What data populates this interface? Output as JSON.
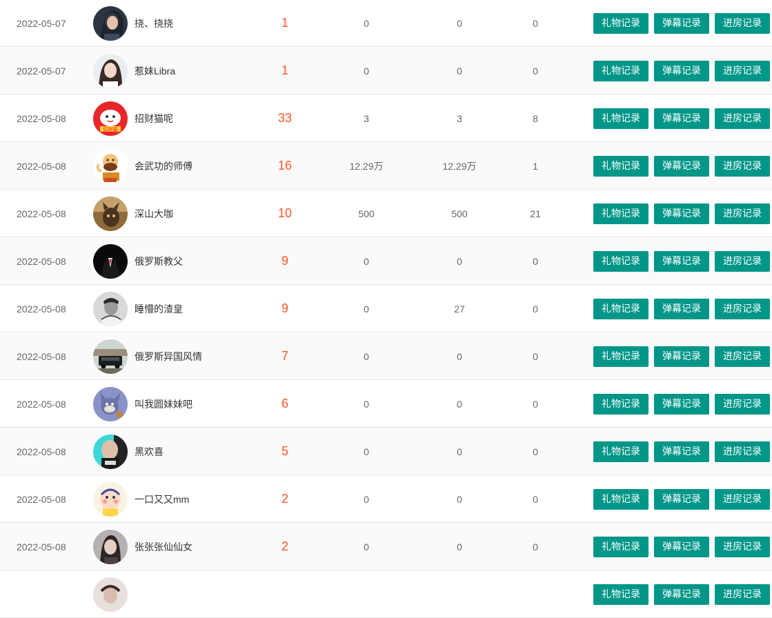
{
  "buttons": {
    "gift": "礼物记录",
    "danmu": "弹幕记录",
    "enter": "进房记录"
  },
  "rows": [
    {
      "date": "2022-05-07",
      "name": "挠、挠挠",
      "count": "1",
      "v1": "0",
      "v2": "0",
      "v3": "0",
      "avatar": "avatar-woman-dark-hair"
    },
    {
      "date": "2022-05-07",
      "name": "惹妹Libra",
      "count": "1",
      "v1": "0",
      "v2": "0",
      "v3": "0",
      "avatar": "avatar-woman-light"
    },
    {
      "date": "2022-05-08",
      "name": "招财猫呢",
      "count": "33",
      "v1": "3",
      "v2": "3",
      "v3": "8",
      "avatar": "avatar-lucky-cat"
    },
    {
      "date": "2022-05-08",
      "name": "会武功的师傅",
      "count": "16",
      "v1": "12.29万",
      "v2": "12.29万",
      "v3": "1",
      "avatar": "avatar-cartoon-master"
    },
    {
      "date": "2022-05-08",
      "name": "深山大咖",
      "count": "10",
      "v1": "500",
      "v2": "500",
      "v3": "21",
      "avatar": "avatar-animal"
    },
    {
      "date": "2022-05-08",
      "name": "俄罗斯教父",
      "count": "9",
      "v1": "0",
      "v2": "0",
      "v3": "0",
      "avatar": "avatar-suit"
    },
    {
      "date": "2022-05-08",
      "name": "睡懵的渣皇",
      "count": "9",
      "v1": "0",
      "v2": "27",
      "v3": "0",
      "avatar": "avatar-man-bw"
    },
    {
      "date": "2022-05-08",
      "name": "俄罗斯异国风情",
      "count": "7",
      "v1": "0",
      "v2": "0",
      "v3": "0",
      "avatar": "avatar-car"
    },
    {
      "date": "2022-05-08",
      "name": "叫我圆妹妹吧",
      "count": "6",
      "v1": "0",
      "v2": "0",
      "v3": "0",
      "avatar": "avatar-tom-cat"
    },
    {
      "date": "2022-05-08",
      "name": "黑欢喜",
      "count": "5",
      "v1": "0",
      "v2": "0",
      "v3": "0",
      "avatar": "avatar-man-bald"
    },
    {
      "date": "2022-05-08",
      "name": "一口又又mm",
      "count": "2",
      "v1": "0",
      "v2": "0",
      "v3": "0",
      "avatar": "avatar-cartoon-baby"
    },
    {
      "date": "2022-05-08",
      "name": "张张张仙仙女",
      "count": "2",
      "v1": "0",
      "v2": "0",
      "v3": "0",
      "avatar": "avatar-woman-portrait"
    },
    {
      "date": "",
      "name": "",
      "count": "",
      "v1": "",
      "v2": "",
      "v3": "",
      "avatar": "avatar-partial"
    }
  ],
  "colors": {
    "accent": "#009688",
    "count": "#FF5722"
  }
}
